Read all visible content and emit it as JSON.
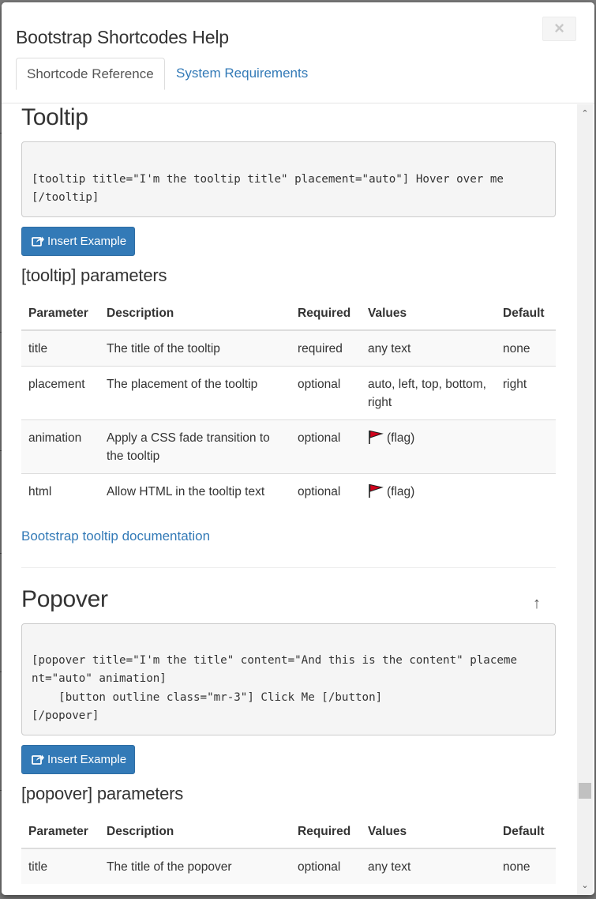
{
  "dialog": {
    "title": "Bootstrap Shortcodes Help",
    "close_label": "×"
  },
  "tabs": [
    {
      "label": "Shortcode Reference",
      "active": true
    },
    {
      "label": "System Requirements",
      "active": false
    }
  ],
  "tooltip_section": {
    "heading": "Tooltip",
    "code_lines": [
      "[tooltip title=\"I'm the tooltip title\" placement=\"auto\"] Hover over me",
      "[/tooltip]"
    ],
    "insert_button": "Insert Example",
    "params_heading": "[tooltip] parameters",
    "columns": [
      "Parameter",
      "Description",
      "Required",
      "Values",
      "Default"
    ],
    "rows": [
      {
        "param": "title",
        "desc": "The title of the tooltip",
        "required": "required",
        "values": "any text",
        "flag": false,
        "default": "none"
      },
      {
        "param": "placement",
        "desc": "The placement of the tooltip",
        "required": "optional",
        "values": "auto, left, top, bottom, right",
        "flag": false,
        "default": "right"
      },
      {
        "param": "animation",
        "desc": "Apply a CSS fade transition to the tooltip",
        "required": "optional",
        "values": "(flag)",
        "flag": true,
        "default": ""
      },
      {
        "param": "html",
        "desc": "Allow HTML in the tooltip text",
        "required": "optional",
        "values": "(flag)",
        "flag": true,
        "default": ""
      }
    ],
    "doc_link": "Bootstrap tooltip documentation"
  },
  "popover_section": {
    "heading": "Popover",
    "back_to_top_icon": "up-arrow-icon",
    "code_lines": [
      "[popover title=\"I'm the title\" content=\"And this is the content\" placeme",
      "nt=\"auto\" animation]",
      "    [button outline class=\"mr-3\"] Click Me [/button]",
      "[/popover]"
    ],
    "insert_button": "Insert Example",
    "params_heading": "[popover] parameters",
    "columns": [
      "Parameter",
      "Description",
      "Required",
      "Values",
      "Default"
    ],
    "rows": [
      {
        "param": "title",
        "desc": "The title of the popover",
        "required": "optional",
        "values": "any text",
        "flag": false,
        "default": "none"
      }
    ]
  },
  "colors": {
    "primary": "#337ab7",
    "link": "#337ab7",
    "flag_red": "#d0021b"
  }
}
